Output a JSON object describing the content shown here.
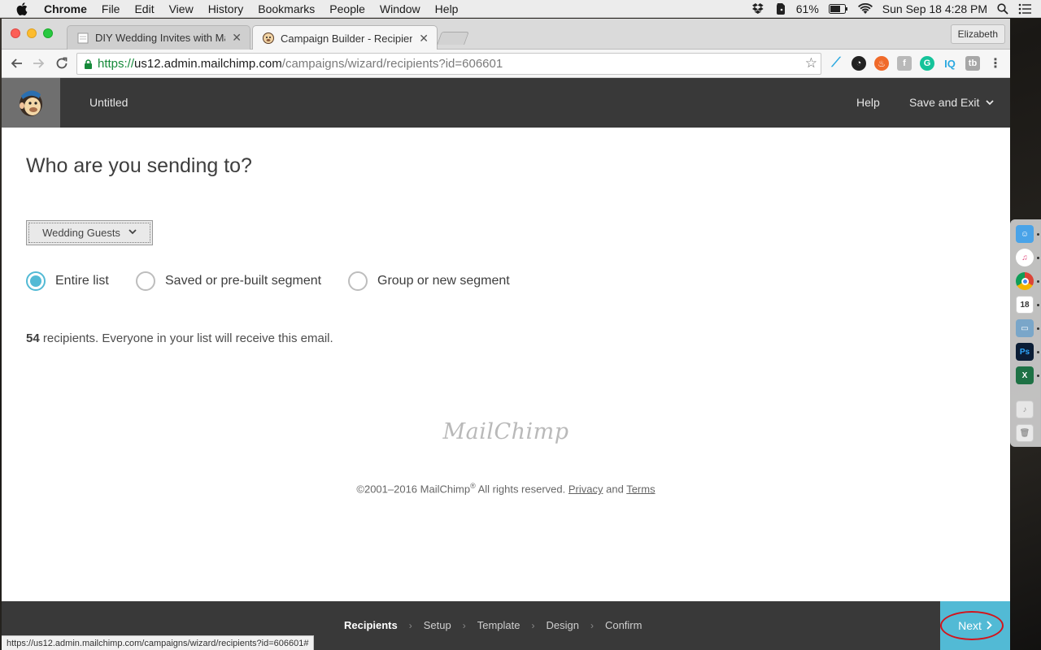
{
  "menubar": {
    "items": [
      "Chrome",
      "File",
      "Edit",
      "View",
      "History",
      "Bookmarks",
      "People",
      "Window",
      "Help"
    ],
    "battery": "61%",
    "clock": "Sun Sep 18  4:28 PM"
  },
  "browser": {
    "tabs": [
      {
        "title": "DIY Wedding Invites with Mailc"
      },
      {
        "title": "Campaign Builder - Recipients"
      }
    ],
    "profile": "Elizabeth",
    "url": {
      "scheme": "https://",
      "host": "us12.admin.mailchimp.com",
      "path": "/campaigns/wizard/recipients?id=606601"
    },
    "status_url": "https://us12.admin.mailchimp.com/campaigns/wizard/recipients?id=606601#"
  },
  "app": {
    "campaign_name": "Untitled",
    "help": "Help",
    "save_exit": "Save and Exit"
  },
  "recipients": {
    "heading": "Who are you sending to?",
    "list_name": "Wedding Guests",
    "options": [
      {
        "label": "Entire list",
        "checked": true
      },
      {
        "label": "Saved or pre-built segment",
        "checked": false
      },
      {
        "label": "Group or new segment",
        "checked": false
      }
    ],
    "count": "54",
    "count_text": "recipients. Everyone in your list will receive this email."
  },
  "footer": {
    "logo_text": "MailChimp",
    "copyright_pre": "©2001–2016 MailChimp",
    "reg": "®",
    "copyright_post": " All rights reserved. ",
    "privacy": "Privacy",
    "and": "and",
    "terms": "Terms"
  },
  "wizard": {
    "steps": [
      "Recipients",
      "Setup",
      "Template",
      "Design",
      "Confirm"
    ],
    "active_step": "Recipients",
    "next": "Next"
  },
  "colors": {
    "accent": "#52bad5",
    "header": "#393939",
    "highlight_ring": "#d3141c"
  }
}
